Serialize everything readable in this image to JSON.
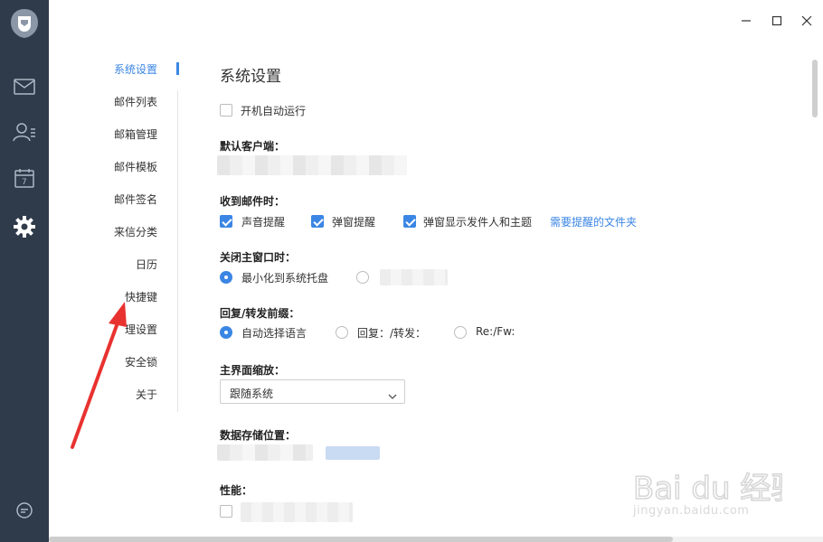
{
  "window": {
    "minimize_icon": "minimize-icon",
    "maximize_icon": "maximize-icon",
    "close_icon": "close-icon"
  },
  "left_sidebar": {
    "icons": [
      "app-logo-icon",
      "mail-icon",
      "contacts-icon",
      "calendar-icon",
      "settings-icon",
      "chat-icon"
    ],
    "calendar_day": "7"
  },
  "nav": {
    "items": [
      {
        "label": "系统设置",
        "active": true
      },
      {
        "label": "邮件列表"
      },
      {
        "label": "邮箱管理"
      },
      {
        "label": "邮件模板"
      },
      {
        "label": "邮件签名"
      },
      {
        "label": "来信分类"
      },
      {
        "label": "日历"
      },
      {
        "label": "快捷键"
      },
      {
        "label": "代理设置",
        "partial_visible": "理设置"
      },
      {
        "label": "安全锁"
      },
      {
        "label": "关于"
      }
    ]
  },
  "main": {
    "title": "系统设置",
    "autostart": {
      "label": "开机自动运行",
      "checked": false
    },
    "default_client": {
      "label": "默认客户端："
    },
    "on_receive": {
      "label": "收到邮件时：",
      "options": [
        {
          "label": "声音提醒",
          "checked": true
        },
        {
          "label": "弹窗提醒",
          "checked": true
        },
        {
          "label": "弹窗显示发件人和主题",
          "checked": true
        }
      ],
      "link": "需要提醒的文件夹"
    },
    "on_close": {
      "label": "关闭主窗口时：",
      "option1": "最小化到系统托盘"
    },
    "reply_prefix": {
      "label": "回复/转发前缀：",
      "options": [
        "自动选择语言",
        "回复：/转发：",
        "Re:/Fw:"
      ]
    },
    "zoom": {
      "label": "主界面缩放：",
      "value": "跟随系统"
    },
    "storage": {
      "label": "数据存储位置："
    },
    "performance": {
      "label": "性能："
    }
  },
  "watermark": {
    "brand": "Bai du 经验",
    "url": "jingyan.baidu.com"
  },
  "colors": {
    "sidebar": "#2f3a4a",
    "accent": "#3b86e4",
    "annotation": "#e8322f"
  }
}
